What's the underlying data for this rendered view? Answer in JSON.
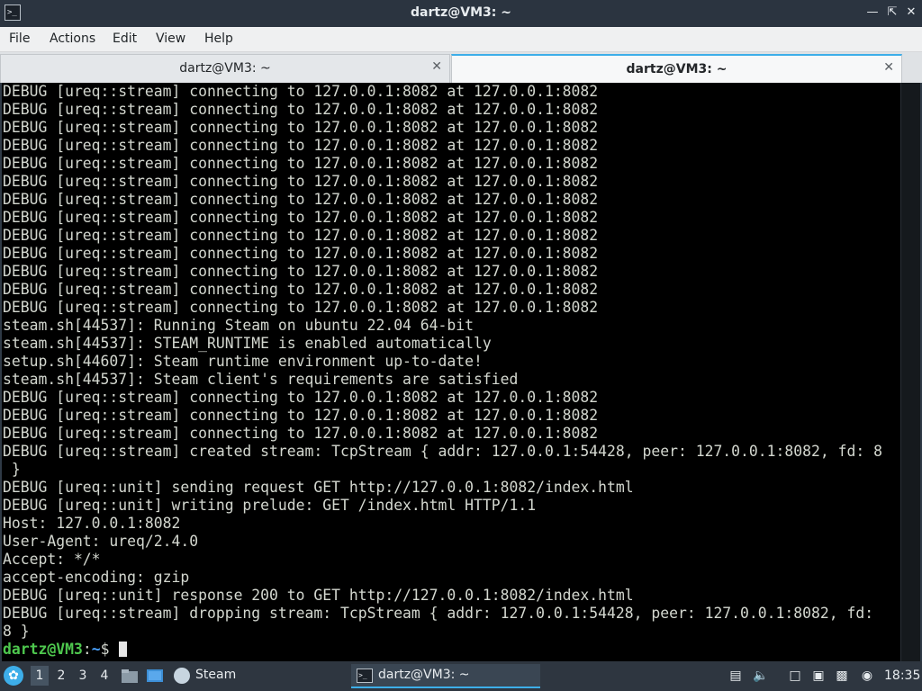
{
  "window": {
    "title": "dartz@VM3: ~",
    "icon": "terminal-icon"
  },
  "menu": [
    "File",
    "Actions",
    "Edit",
    "View",
    "Help"
  ],
  "tabs": [
    {
      "label": "dartz@VM3: ~",
      "active": false
    },
    {
      "label": "dartz@VM3: ~",
      "active": true
    }
  ],
  "terminal": {
    "lines": [
      "DEBUG [ureq::stream] connecting to 127.0.0.1:8082 at 127.0.0.1:8082",
      "DEBUG [ureq::stream] connecting to 127.0.0.1:8082 at 127.0.0.1:8082",
      "DEBUG [ureq::stream] connecting to 127.0.0.1:8082 at 127.0.0.1:8082",
      "DEBUG [ureq::stream] connecting to 127.0.0.1:8082 at 127.0.0.1:8082",
      "DEBUG [ureq::stream] connecting to 127.0.0.1:8082 at 127.0.0.1:8082",
      "DEBUG [ureq::stream] connecting to 127.0.0.1:8082 at 127.0.0.1:8082",
      "DEBUG [ureq::stream] connecting to 127.0.0.1:8082 at 127.0.0.1:8082",
      "DEBUG [ureq::stream] connecting to 127.0.0.1:8082 at 127.0.0.1:8082",
      "DEBUG [ureq::stream] connecting to 127.0.0.1:8082 at 127.0.0.1:8082",
      "DEBUG [ureq::stream] connecting to 127.0.0.1:8082 at 127.0.0.1:8082",
      "DEBUG [ureq::stream] connecting to 127.0.0.1:8082 at 127.0.0.1:8082",
      "DEBUG [ureq::stream] connecting to 127.0.0.1:8082 at 127.0.0.1:8082",
      "DEBUG [ureq::stream] connecting to 127.0.0.1:8082 at 127.0.0.1:8082",
      "steam.sh[44537]: Running Steam on ubuntu 22.04 64-bit",
      "steam.sh[44537]: STEAM_RUNTIME is enabled automatically",
      "setup.sh[44607]: Steam runtime environment up-to-date!",
      "steam.sh[44537]: Steam client's requirements are satisfied",
      "DEBUG [ureq::stream] connecting to 127.0.0.1:8082 at 127.0.0.1:8082",
      "DEBUG [ureq::stream] connecting to 127.0.0.1:8082 at 127.0.0.1:8082",
      "DEBUG [ureq::stream] connecting to 127.0.0.1:8082 at 127.0.0.1:8082",
      "DEBUG [ureq::stream] created stream: TcpStream { addr: 127.0.0.1:54428, peer: 127.0.0.1:8082, fd: 8",
      " }",
      "DEBUG [ureq::unit] sending request GET http://127.0.0.1:8082/index.html",
      "DEBUG [ureq::unit] writing prelude: GET /index.html HTTP/1.1",
      "Host: 127.0.0.1:8082",
      "User-Agent: ureq/2.4.0",
      "Accept: */*",
      "accept-encoding: gzip",
      "DEBUG [ureq::unit] response 200 to GET http://127.0.0.1:8082/index.html",
      "DEBUG [ureq::stream] dropping stream: TcpStream { addr: 127.0.0.1:54428, peer: 127.0.0.1:8082, fd:",
      "8 }"
    ],
    "prompt": {
      "user_host": "dartz@VM3",
      "separator": ":",
      "path": "~",
      "symbol": "$ "
    }
  },
  "taskbar": {
    "workspaces": [
      "1",
      "2",
      "3",
      "4"
    ],
    "active_workspace": "1",
    "steam_label": "Steam",
    "task_label": "dartz@VM3: ~",
    "clock": "18:35"
  },
  "colors": {
    "accent": "#3daee9",
    "prompt_user": "#4ec84e",
    "prompt_path": "#4aa3ff",
    "terminal_bg": "#000000",
    "terminal_fg": "#d3d7cf"
  }
}
